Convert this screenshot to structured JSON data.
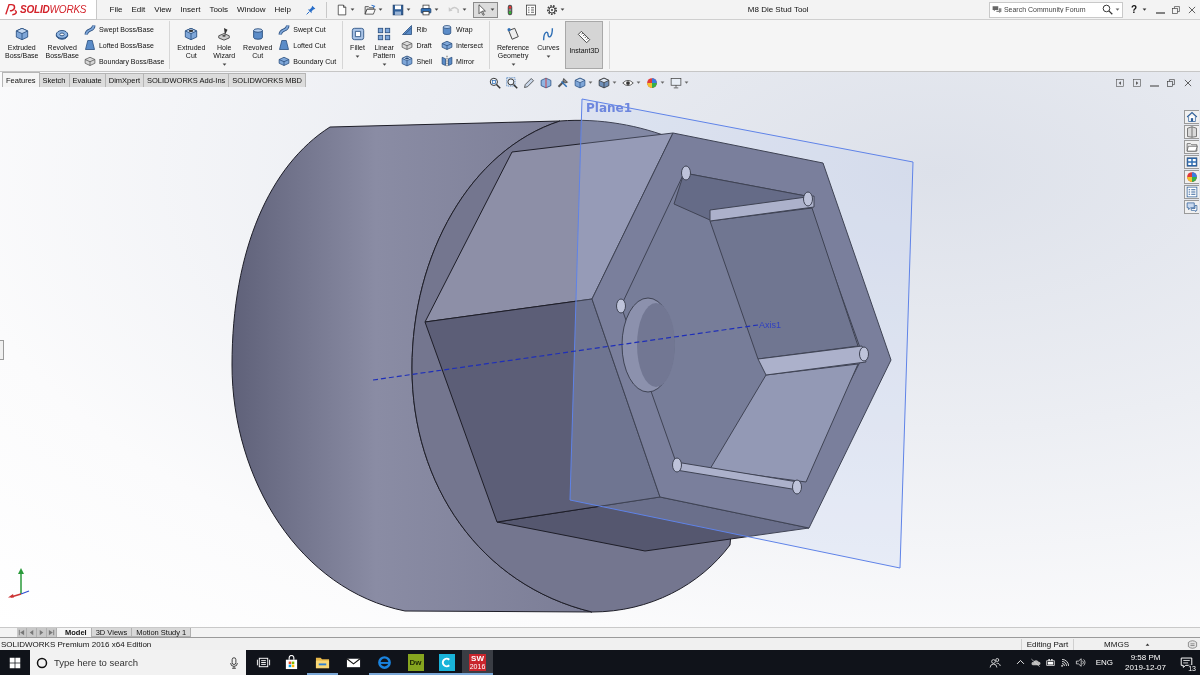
{
  "title_bar": {
    "logo": "**SOLID**WORKS",
    "menu": [
      "File",
      "Edit",
      "View",
      "Insert",
      "Tools",
      "Window",
      "Help"
    ],
    "quick_access": [
      {
        "pressed": false,
        "disabled": false
      },
      {
        "pressed": false,
        "disabled": false
      },
      {
        "pressed": false,
        "disabled": false
      },
      {
        "pressed": false,
        "disabled": false
      },
      {
        "pressed": false,
        "disabled": true
      },
      {
        "pressed": true,
        "disabled": false
      },
      {
        "pressed": false,
        "disabled": false
      },
      {
        "pressed": false,
        "disabled": false
      },
      {
        "pressed": false,
        "disabled": false
      }
    ],
    "title": "M8 Die Stud Tool",
    "search": {
      "placeholder": "Search Community Forum"
    },
    "help": "?"
  },
  "command_manager": {
    "groups": [
      {
        "columns": [
          {
            "kind": "large",
            "label": "Extruded Boss/Base",
            "dropdown": false,
            "pressed": false
          },
          {
            "kind": "large",
            "label": "Revolved Boss/Base",
            "dropdown": false,
            "pressed": false
          },
          {
            "kind": "stack",
            "items": [
              "Swept Boss/Base",
              "Lofted Boss/Base",
              "Boundary Boss/Base"
            ]
          }
        ]
      },
      {
        "columns": [
          {
            "kind": "large",
            "label": "Extruded Cut",
            "dropdown": false,
            "pressed": false
          },
          {
            "kind": "large",
            "label": "Hole Wizard",
            "dropdown": true,
            "pressed": false
          },
          {
            "kind": "large",
            "label": "Revolved Cut",
            "dropdown": false,
            "pressed": false
          },
          {
            "kind": "stack",
            "items": [
              "Swept Cut",
              "Lofted Cut",
              "Boundary Cut"
            ]
          }
        ]
      },
      {
        "columns": [
          {
            "kind": "large",
            "label": "Fillet",
            "dropdown": true,
            "pressed": false
          },
          {
            "kind": "large",
            "label": "Linear Pattern",
            "dropdown": true,
            "pressed": false
          },
          {
            "kind": "stack",
            "items": [
              "Rib",
              "Draft",
              "Shell"
            ]
          },
          {
            "kind": "stack",
            "items": [
              "Wrap",
              "Intersect",
              "Mirror"
            ]
          }
        ]
      },
      {
        "columns": [
          {
            "kind": "large",
            "label": "Reference Geometry",
            "dropdown": true,
            "pressed": false
          },
          {
            "kind": "large",
            "label": "Curves",
            "dropdown": true,
            "pressed": false
          },
          {
            "kind": "large",
            "label": "Instant3D",
            "dropdown": false,
            "pressed": true
          }
        ]
      }
    ]
  },
  "tabs": [
    {
      "label": "Features",
      "selected": true
    },
    {
      "label": "Sketch",
      "selected": false
    },
    {
      "label": "Evaluate",
      "selected": false
    },
    {
      "label": "DimXpert",
      "selected": false
    },
    {
      "label": "SOLIDWORKS Add-Ins",
      "selected": false
    },
    {
      "label": "SOLIDWORKS MBD",
      "selected": false
    }
  ],
  "viewport": {
    "plane_label": "Plane1",
    "axis_label": "Axis1"
  },
  "bottom_tabs": [
    {
      "label": "Model",
      "selected": true
    },
    {
      "label": "3D Views",
      "selected": false
    },
    {
      "label": "Motion Study 1",
      "selected": false
    }
  ],
  "status_bar": {
    "edition": "SOLIDWORKS Premium 2016 x64 Edition",
    "mode": "Editing Part",
    "units": "MMGS"
  },
  "taskbar": {
    "search": {
      "placeholder": "Type here to search"
    },
    "apps": [
      {
        "kind": "taskview",
        "running": false,
        "selected": false
      },
      {
        "kind": "store",
        "running": false,
        "selected": false
      },
      {
        "kind": "explorer",
        "running": true,
        "selected": false
      },
      {
        "kind": "mail",
        "running": false,
        "selected": false
      },
      {
        "kind": "browser",
        "running": true,
        "selected": false
      },
      {
        "kind": "tile",
        "label": "Dw",
        "color": "#86a51f",
        "running": true,
        "selected": false
      },
      {
        "kind": "ringtile",
        "color": "#19b3d9",
        "running": true,
        "selected": false
      },
      {
        "kind": "tile",
        "label": "SW",
        "badge": "2016",
        "color": "#c8252c",
        "running": true,
        "selected": true
      }
    ],
    "language": "ENG",
    "time": "9:58 PM",
    "date": "2019-12-07",
    "notifications": "13"
  }
}
